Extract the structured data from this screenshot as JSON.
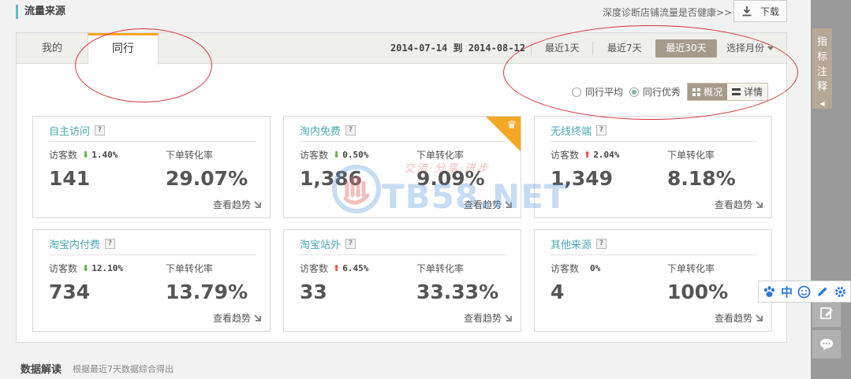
{
  "header": {
    "section_title": "流量来源",
    "diag_link": "深度诊断店铺流量是否健康>>",
    "download_label": "下载"
  },
  "tabs": [
    {
      "label": "我的",
      "active": false
    },
    {
      "label": "同行",
      "active": true
    }
  ],
  "date_range": "2014-07-14 到 2014-08-12",
  "ranges": {
    "r1": "最近1天",
    "r7": "最近7天",
    "r30": "最近30天",
    "month": "选择月份"
  },
  "compare": {
    "avg_label": "同行平均",
    "best_label": "同行优秀",
    "selected": "best"
  },
  "view": {
    "overview_label": "概况",
    "detail_label": "详情"
  },
  "metric_labels": {
    "visitors": "访客数",
    "conversion": "下单转化率",
    "trend": "查看趋势"
  },
  "cards": [
    {
      "title": "自主访问",
      "direction": "down",
      "change": "1.40%",
      "visitors": "141",
      "conversion": "29.07%",
      "crown": false
    },
    {
      "title": "淘内免费",
      "direction": "down",
      "change": "0.50%",
      "visitors": "1,386",
      "conversion": "9.09%",
      "crown": true
    },
    {
      "title": "无线终端",
      "direction": "up",
      "change": "2.04%",
      "visitors": "1,349",
      "conversion": "8.18%",
      "crown": false
    },
    {
      "title": "淘宝内付费",
      "direction": "down",
      "change": "12.10%",
      "visitors": "734",
      "conversion": "13.79%",
      "crown": false
    },
    {
      "title": "淘宝站外",
      "direction": "up",
      "change": "6.45%",
      "visitors": "33",
      "conversion": "33.33%",
      "crown": false
    },
    {
      "title": "其他来源",
      "direction": "none",
      "change": "0%",
      "visitors": "4",
      "conversion": "100%",
      "crown": false
    }
  ],
  "footer": {
    "title": "数据解读",
    "subtitle": "根据最近7天数据综合得出"
  },
  "side": {
    "note_label": "指标注释"
  },
  "ime": {
    "lang": "中"
  },
  "watermark": {
    "text": "TB58.NET",
    "slogan": "交流·分享·进步"
  },
  "colors": {
    "accent_teal": "#4aa8b4",
    "tab_orange": "#f5a623",
    "active_range": "#a69b8b",
    "down_arrow": "#6ab04c",
    "up_arrow": "#e05a4e",
    "annotation_red": "#d9333b"
  }
}
